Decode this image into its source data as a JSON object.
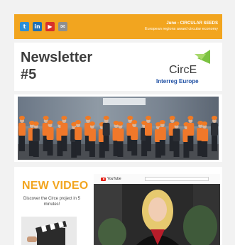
{
  "social": {
    "icons": [
      "twitter-icon",
      "linkedin-icon",
      "youtube-icon",
      "email-icon"
    ],
    "glyphs": [
      "t",
      "in",
      "▶",
      "✉"
    ]
  },
  "banner": {
    "title": "June - CIRCULAR SEEDS",
    "subtitle": "European regions award circular economy"
  },
  "header": {
    "title_line1": "Newsletter",
    "title_line2": "#5",
    "logo_name": "CircE",
    "logo_sub": "Interreg Europe"
  },
  "video": {
    "heading": "NEW VIDEO",
    "description": "Discover the Circe project in 5 minutes!",
    "player_brand": "YouTube"
  },
  "colors": {
    "accent": "#f2a51f",
    "logo_green": "#7cc242",
    "interreg_blue": "#1e4fa3"
  }
}
